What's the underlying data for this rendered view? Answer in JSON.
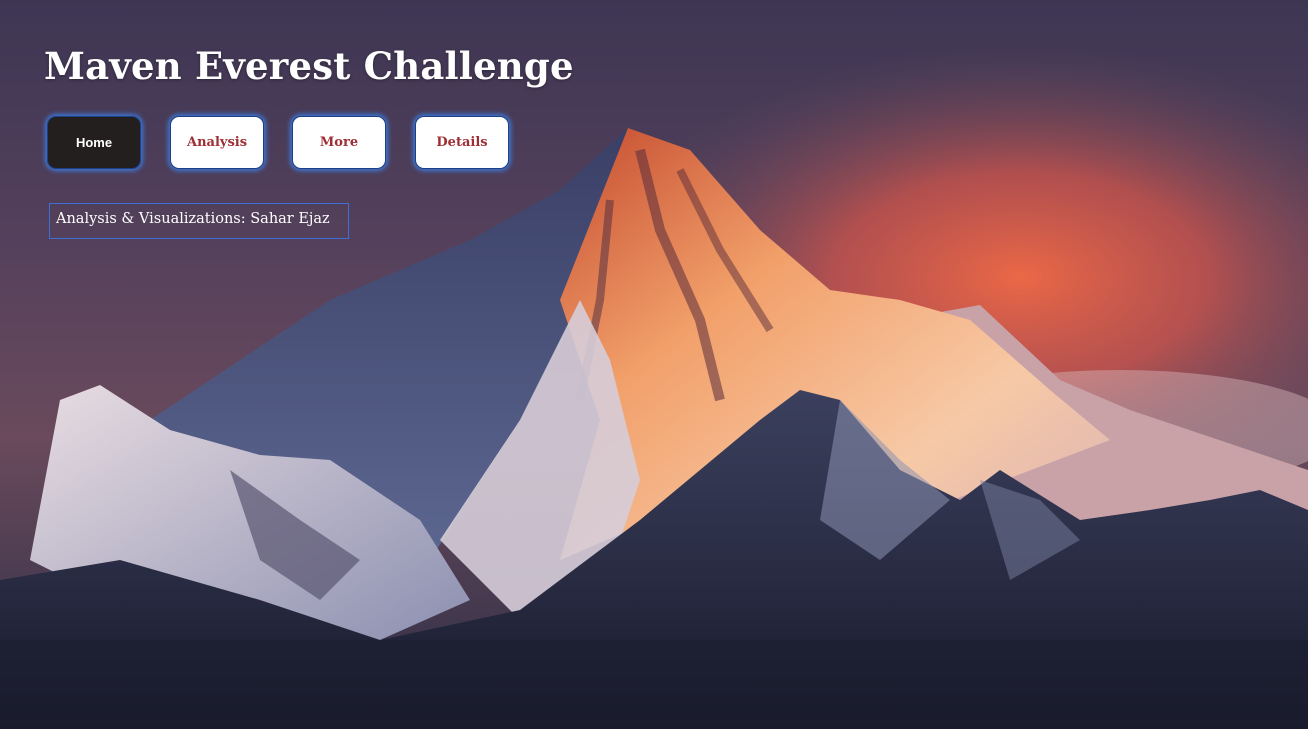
{
  "header": {
    "title": "Maven Everest Challenge"
  },
  "nav": {
    "home_label": "Home",
    "analysis_label": "Analysis",
    "more_label": "More",
    "details_label": "Details",
    "active": "Home"
  },
  "credit": {
    "text": "Analysis & Visualizations: Sahar Ejaz"
  },
  "colors": {
    "active_button_bg": "#231f1f",
    "button_text": "#9e2e34",
    "button_glow": "#3c82eb",
    "sky_top": "#4a3a55",
    "sunset_glow": "#f0643f"
  },
  "background": {
    "image": "mountain-everest-sunset"
  }
}
